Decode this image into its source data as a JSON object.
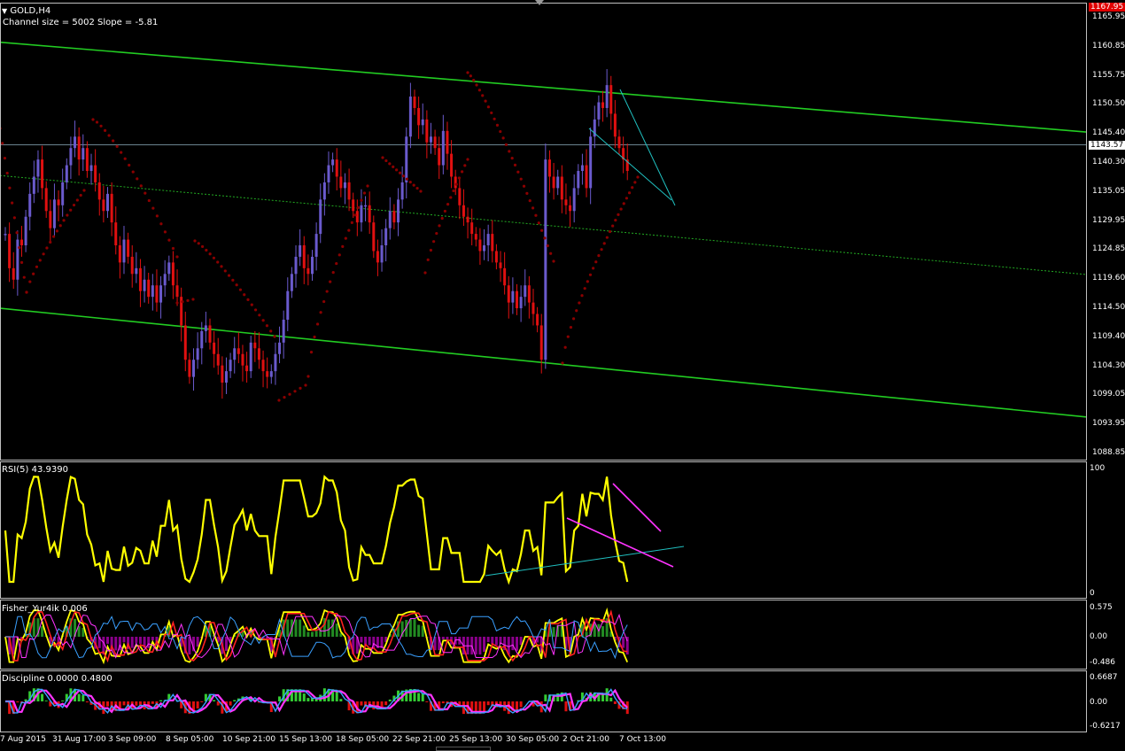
{
  "symbol_label": "GOLD,H4",
  "channel_info": "Channel size = 5002 Slope = -5.81",
  "colors": {
    "background": "#000000",
    "bull_bar": "#6a5acd",
    "bear_bar": "#e01010",
    "sar": "#8b0000",
    "channel": "#22cc22",
    "mid_channel": "#22aa22",
    "trendline": "#20c0c0",
    "rsi": "#ffff00",
    "magenta": "#ff33ff",
    "price_line": "#8fb0c0",
    "current_tag": "#e00000",
    "grid_text": "#ffffff"
  },
  "price_axis": {
    "labels": [
      "1165.95",
      "1160.85",
      "1155.75",
      "1150.50",
      "1145.40",
      "1140.30",
      "1135.05",
      "1129.95",
      "1124.85",
      "1119.60",
      "1114.50",
      "1109.40",
      "1104.30",
      "1099.05",
      "1093.95",
      "1088.85"
    ],
    "top_tag": "1167.95",
    "current_tag": "1143.57"
  },
  "rsi_panel": {
    "label": "RSI(5) 43.9390",
    "axis": [
      "100",
      "0"
    ]
  },
  "fisher_panel": {
    "label": "Fisher_Yur4ik 0.006",
    "axis": [
      "0.575",
      "0.00",
      "-0.486"
    ]
  },
  "discipline_panel": {
    "label": "Discipline 0.0000 0.4800",
    "axis": [
      "0.6687",
      "0.00",
      "-0.6217"
    ]
  },
  "time_axis": [
    "7 Aug 2015",
    "31 Aug 17:00",
    "3 Sep 09:00",
    "8 Sep 05:00",
    "10 Sep 21:00",
    "15 Sep 13:00",
    "18 Sep 05:00",
    "22 Sep 21:00",
    "25 Sep 13:00",
    "30 Sep 05:00",
    "2 Oct 21:00",
    "7 Oct 13:00"
  ],
  "chart_data": {
    "type": "candlestick",
    "instrument": "GOLD",
    "timeframe": "H4",
    "ylim": [
      1088.85,
      1167.95
    ],
    "current_price": 1143.57,
    "rsi_ylim": [
      0,
      100
    ],
    "rsi_current": 43.939,
    "channel": {
      "size": 5002,
      "slope": -5.81
    },
    "price_closes": [
      1128,
      1122,
      1120,
      1127,
      1126,
      1131,
      1135,
      1138,
      1141,
      1136,
      1132,
      1129,
      1134,
      1133,
      1137,
      1140,
      1143,
      1145,
      1141,
      1143,
      1139,
      1140,
      1137,
      1134,
      1132,
      1135,
      1130,
      1126,
      1123,
      1127,
      1124,
      1121,
      1122,
      1118,
      1120,
      1117,
      1119,
      1116,
      1119,
      1121,
      1123,
      1119,
      1117,
      1112,
      1106,
      1103,
      1106,
      1108,
      1111,
      1112,
      1109,
      1107,
      1105,
      1102,
      1104,
      1106,
      1108,
      1107,
      1105,
      1104,
      1109,
      1108,
      1106,
      1104,
      1103,
      1104,
      1107,
      1109,
      1113,
      1118,
      1121,
      1124,
      1126,
      1122,
      1121,
      1124,
      1128,
      1134,
      1137,
      1140,
      1141,
      1138,
      1136,
      1137,
      1134,
      1132,
      1130,
      1133,
      1133,
      1130,
      1125,
      1123,
      1126,
      1129,
      1132,
      1130,
      1134,
      1137,
      1145,
      1152,
      1150,
      1147,
      1148,
      1144,
      1145,
      1143,
      1140,
      1146,
      1142,
      1138,
      1136,
      1133,
      1131,
      1130,
      1128,
      1127,
      1125,
      1126,
      1128,
      1125,
      1123,
      1122,
      1119,
      1116,
      1118,
      1115,
      1117,
      1119,
      1116,
      1114,
      1112,
      1106,
      1141,
      1138,
      1136,
      1138,
      1134,
      1133,
      1132,
      1136,
      1139,
      1140,
      1136,
      1145,
      1148,
      1151,
      1150,
      1154,
      1149,
      1145,
      1143,
      1141,
      1139
    ]
  }
}
